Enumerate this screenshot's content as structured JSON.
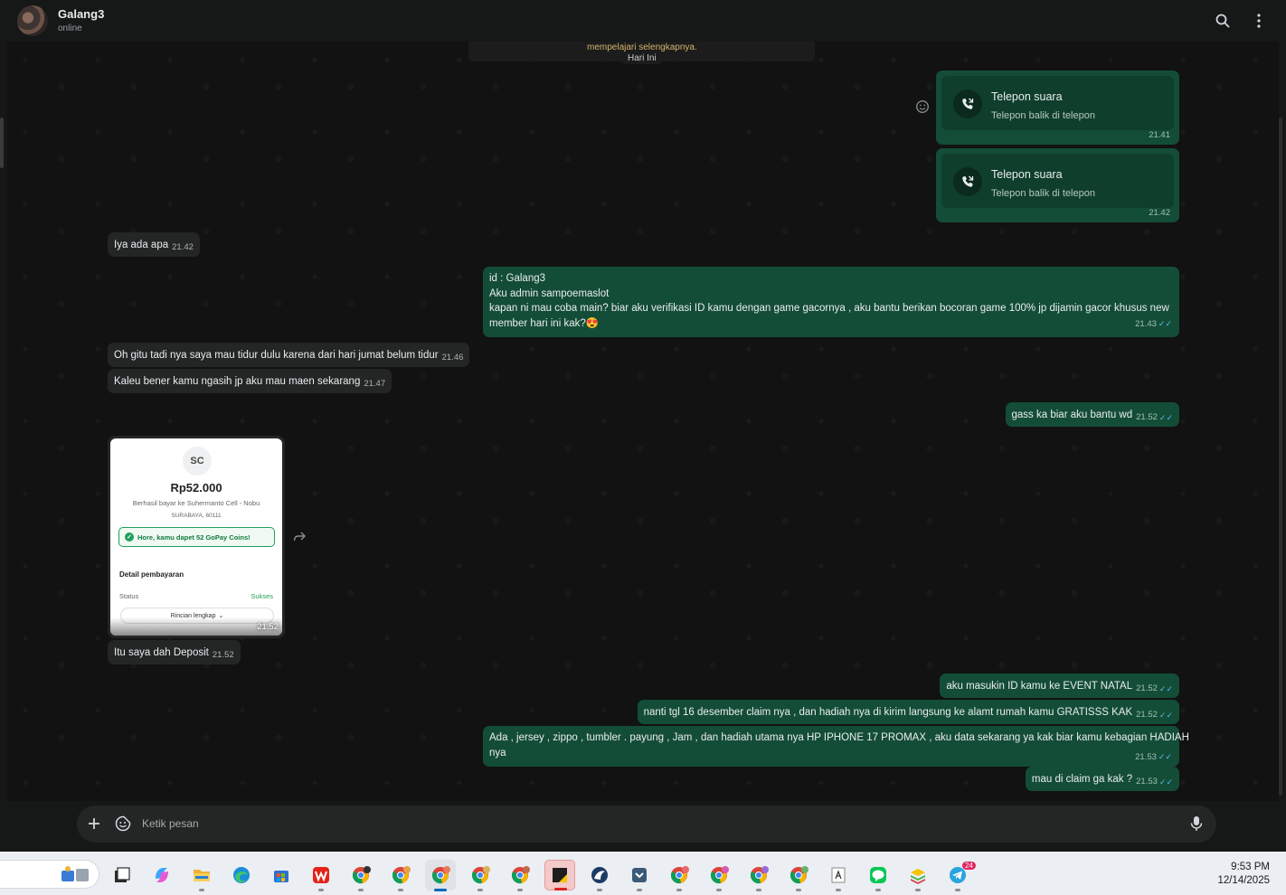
{
  "header": {
    "contact_name": "Galang3",
    "status": "online"
  },
  "system": {
    "notice_fragment": "mempelajari selengkapnya.",
    "date_chip": "Hari Ini"
  },
  "calls": [
    {
      "title": "Telepon suara",
      "subtitle": "Telepon balik di telepon",
      "time": "21.41"
    },
    {
      "title": "Telepon suara",
      "subtitle": "Telepon balik di telepon",
      "time": "21.42"
    }
  ],
  "messages": {
    "m1": {
      "text": "Iya ada apa",
      "time": "21.42"
    },
    "m2": {
      "lines": [
        "id : Galang3",
        "Aku admin sampoemaslot",
        "kapan ni mau coba main?  biar aku verifikasi ID kamu dengan game gacornya , aku bantu berikan bocoran game 100% jp dijamin gacor khusus new",
        "member hari ini kak?😍"
      ],
      "time": "21.43"
    },
    "m3": {
      "text": "Oh gitu tadi nya saya mau tidur dulu karena dari hari jumat belum tidur",
      "time": "21.46"
    },
    "m4": {
      "text": "Kaleu bener kamu ngasih jp aku mau maen sekarang",
      "time": "21.47"
    },
    "m5": {
      "text": "gass ka biar aku bantu wd",
      "time": "21.52"
    },
    "m6": {
      "text": "Itu saya dah Deposit",
      "time": "21.52"
    },
    "m7": {
      "text": "aku masukin ID kamu ke EVENT NATAL",
      "time": "21.52"
    },
    "m8": {
      "text": "nanti tgl 16 desember claim nya , dan hadiah nya di kirim langsung ke alamt rumah kamu GRATISSS KAK",
      "time": "21.52"
    },
    "m9": {
      "lines": [
        "Ada , jersey , zippo , tumbler . payung , Jam , dan hadiah utama nya HP IPHONE 17 PROMAX , aku data sekarang ya kak biar kamu kebagian HADIAH",
        "nya"
      ],
      "time": "21.53"
    },
    "m10": {
      "text": "mau di claim ga kak ?",
      "time": "21.53"
    }
  },
  "receipt": {
    "logo_text": "SC",
    "amount": "Rp52.000",
    "merchant": "Berhasil bayar ke Suhermanto Cell - Nobu",
    "location": "SURABAYA, 60111",
    "coins_text": "Hore, kamu dapet 52 GoPay Coins!",
    "detail_heading": "Detail pembayaran",
    "status_label": "Status",
    "status_value": "Sukses",
    "more_button": "Rincian lengkap",
    "time": "21.52"
  },
  "composer": {
    "placeholder": "Ketik pesan"
  },
  "taskbar": {
    "time": "9:53 PM",
    "date": "12/14/2025",
    "telegram_badge": "24",
    "apps": [
      "task-view",
      "copilot",
      "file-explorer",
      "edge",
      "microsoft-store",
      "wps-office",
      "chrome-profile-1",
      "chrome-profile-2",
      "chrome-profile-3",
      "chrome-profile-4",
      "chrome-profile-5",
      "sticky-app",
      "browser-bird",
      "pocket",
      "chrome-profile-6",
      "chrome-profile-7",
      "chrome-profile-8",
      "chrome-profile-9",
      "font-viewer",
      "line",
      "bluestacks",
      "telegram"
    ]
  },
  "colors": {
    "incoming_bubble": "#242626",
    "outgoing_bubble": "#144d37",
    "read_ticks": "#53bdeb",
    "background": "#111211"
  }
}
